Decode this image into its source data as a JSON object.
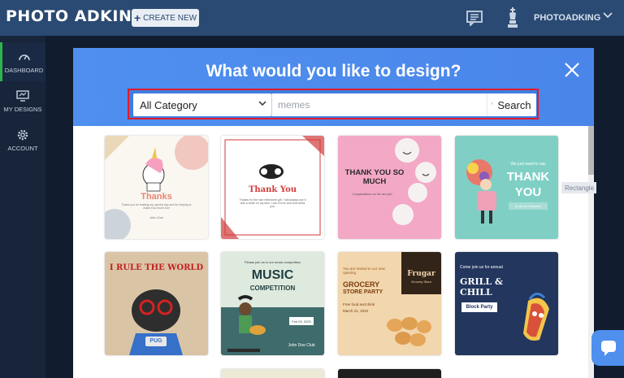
{
  "header": {
    "logo": "PHOTO ADKING",
    "create_button": "CREATE NEW",
    "user_name": "PHOTOADKING"
  },
  "sidebar": {
    "items": [
      {
        "label": "DASHBOARD",
        "icon": "dashboard-icon"
      },
      {
        "label": "MY DESIGNS",
        "icon": "monitor-icon"
      },
      {
        "label": "ACCOUNT",
        "icon": "gear-icon"
      }
    ]
  },
  "modal": {
    "title": "What would you like to design?",
    "category_value": "All Category",
    "search_placeholder": "memes",
    "search_button": "Search"
  },
  "tooltip": "Rectangle",
  "cards": [
    {
      "name": "thanks-unicorn-card",
      "title": "Thanks",
      "body": "Thank you for sharing my special day and for helping to make it so much fun!",
      "sign": "John Doe"
    },
    {
      "name": "thank-you-panda-card",
      "title": "Thank You",
      "body": "Thanks for the nice retirement gift. I will always use it with a smile on my face. Lots of love and God bless you."
    },
    {
      "name": "thank-you-balloons-card",
      "title": "THANK YOU SO MUCH",
      "body": "Congratulations on the new job!"
    },
    {
      "name": "thank-you-flowers-card",
      "intro": "We just want to say",
      "title": "THANK",
      "title2": "YOU",
      "footer": "to all our followers"
    },
    {
      "name": "i-rule-the-world-card",
      "title": "I RULE THE WORLD",
      "badge": "PUG"
    },
    {
      "name": "music-competition-card",
      "intro": "Please join us in our music competition",
      "title": "MUSIC",
      "title2": "COMPETITION",
      "date": "Feb 03, 2023",
      "host": "John Doe Club"
    },
    {
      "name": "grocery-store-party-card",
      "intro": "You are invited to our new opening",
      "title": "GROCERY",
      "title2": "STORE PARTY",
      "brand": "Frugar",
      "brand_sub": "Grocery Store",
      "detail": "Free food and drink",
      "date": "March 21, 2022"
    },
    {
      "name": "grill-and-chill-card",
      "intro": "Come join us for annual",
      "title": "GRILL &",
      "title2": "CHILL",
      "badge": "Block Party"
    }
  ]
}
